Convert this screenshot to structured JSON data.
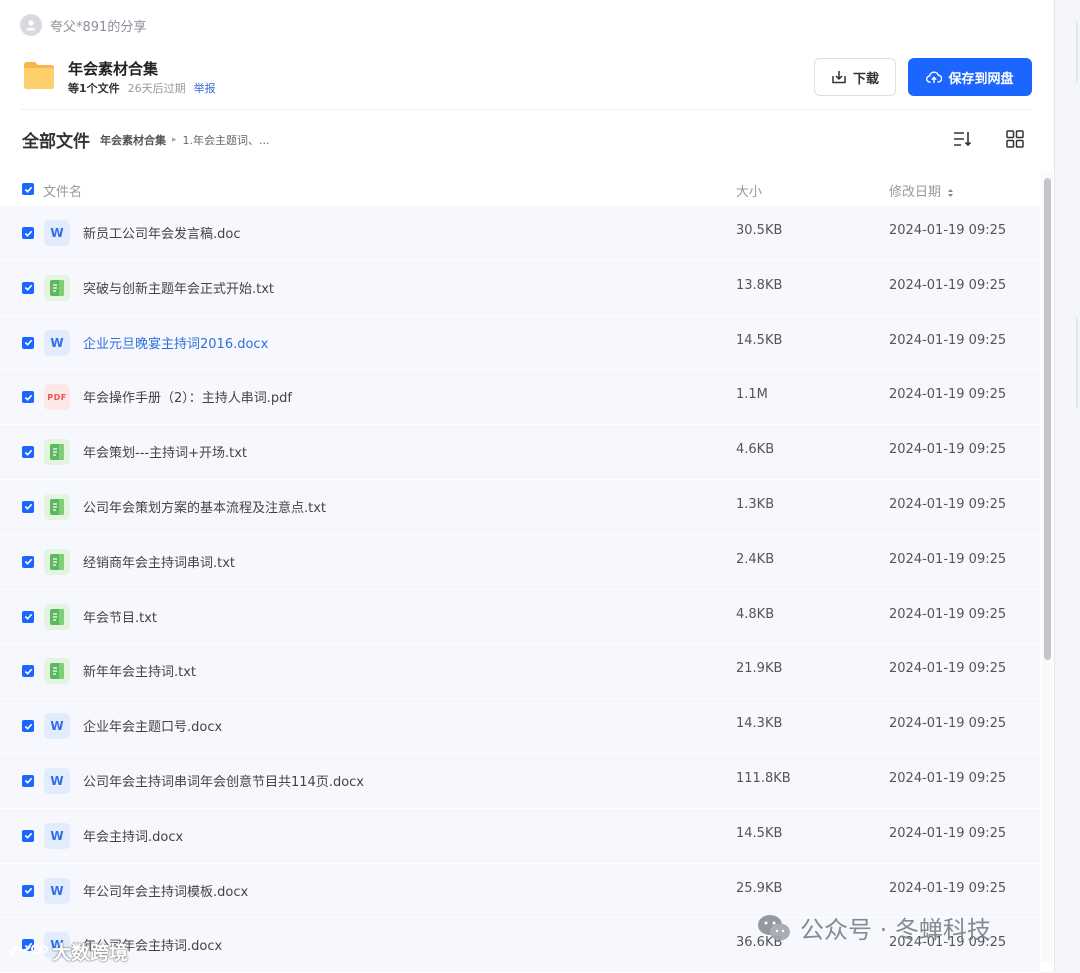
{
  "header": {
    "sharer": "夸父*891的分享",
    "title": "年会素材合集",
    "file_count": "等1个文件",
    "expire": "26天后过期",
    "report": "举报",
    "download_label": "下载",
    "save_label": "保存到网盘"
  },
  "breadcrumb": {
    "root": "全部文件",
    "items": [
      "年会素材合集",
      "1.年会主题词、..."
    ]
  },
  "table": {
    "columns": {
      "name": "文件名",
      "size": "大小",
      "date": "修改日期"
    },
    "rows": [
      {
        "name": "新员工公司年会发言稿.doc",
        "size": "30.5KB",
        "date": "2024-01-19 09:25",
        "type": "word"
      },
      {
        "name": "突破与创新主题年会正式开始.txt",
        "size": "13.8KB",
        "date": "2024-01-19 09:25",
        "type": "txt"
      },
      {
        "name": "企业元旦晚宴主持词2016.docx",
        "size": "14.5KB",
        "date": "2024-01-19 09:25",
        "type": "word"
      },
      {
        "name": "年会操作手册（2）：主持人串词.pdf",
        "size": "1.1M",
        "date": "2024-01-19 09:25",
        "type": "pdf"
      },
      {
        "name": "年会策划---主持词+开场.txt",
        "size": "4.6KB",
        "date": "2024-01-19 09:25",
        "type": "txt"
      },
      {
        "name": "公司年会策划方案的基本流程及注意点.txt",
        "size": "1.3KB",
        "date": "2024-01-19 09:25",
        "type": "txt"
      },
      {
        "name": "经销商年会主持词串词.txt",
        "size": "2.4KB",
        "date": "2024-01-19 09:25",
        "type": "txt"
      },
      {
        "name": "年会节目.txt",
        "size": "4.8KB",
        "date": "2024-01-19 09:25",
        "type": "txt"
      },
      {
        "name": "新年年会主持词.txt",
        "size": "21.9KB",
        "date": "2024-01-19 09:25",
        "type": "txt"
      },
      {
        "name": "企业年会主题口号.docx",
        "size": "14.3KB",
        "date": "2024-01-19 09:25",
        "type": "word"
      },
      {
        "name": "公司年会主持词串词年会创意节目共114页.docx",
        "size": "111.8KB",
        "date": "2024-01-19 09:25",
        "type": "word"
      },
      {
        "name": "年会主持词.docx",
        "size": "14.5KB",
        "date": "2024-01-19 09:25",
        "type": "word"
      },
      {
        "name": "年公司年会主持词模板.docx",
        "size": "25.9KB",
        "date": "2024-01-19 09:25",
        "type": "word"
      },
      {
        "name": "年公司年会主持词.docx",
        "size": "36.6KB",
        "date": "2024-01-19 09:25",
        "type": "word"
      }
    ]
  },
  "icons": {
    "word_letter": "W",
    "pdf_label": "PDF"
  },
  "watermarks": {
    "right": "公众号 · 冬蝉科技",
    "left": "大数跨境"
  },
  "colors": {
    "primary": "#1a66ff",
    "row_bg": "#f7f8fd",
    "link": "#2f6fde"
  }
}
